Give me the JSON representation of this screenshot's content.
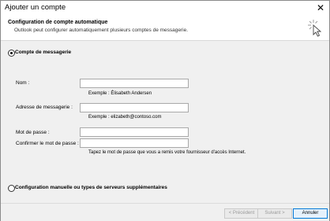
{
  "window": {
    "title": "Ajouter un compte",
    "close_glyph": "✕"
  },
  "header": {
    "title": "Configuration de compte automatique",
    "subtitle": "Outlook peut configurer automatiquement plusieurs comptes de messagerie.",
    "icon": "sparkle-cursor-icon"
  },
  "options": {
    "email_account_label": "Compte de messagerie",
    "manual_label": "Configuration manuelle ou types de serveurs supplémentaires",
    "selected": "email_account"
  },
  "form": {
    "name_label": "Nom :",
    "name_value": "",
    "name_hint": "Exemple : Élisabeth Andersen",
    "email_label": "Adresse de messagerie :",
    "email_value": "",
    "email_hint": "Exemple : elizabeth@contoso.com",
    "password_label": "Mot de passe :",
    "password_value": "",
    "confirm_label": "Confirmer le mot de passe :",
    "confirm_value": "",
    "password_hint": "Tapez le mot de passe que vous a remis votre fournisseur d'accès Internet."
  },
  "buttons": {
    "previous": "< Précédent",
    "next": "Suivant >",
    "cancel": "Annuler"
  }
}
